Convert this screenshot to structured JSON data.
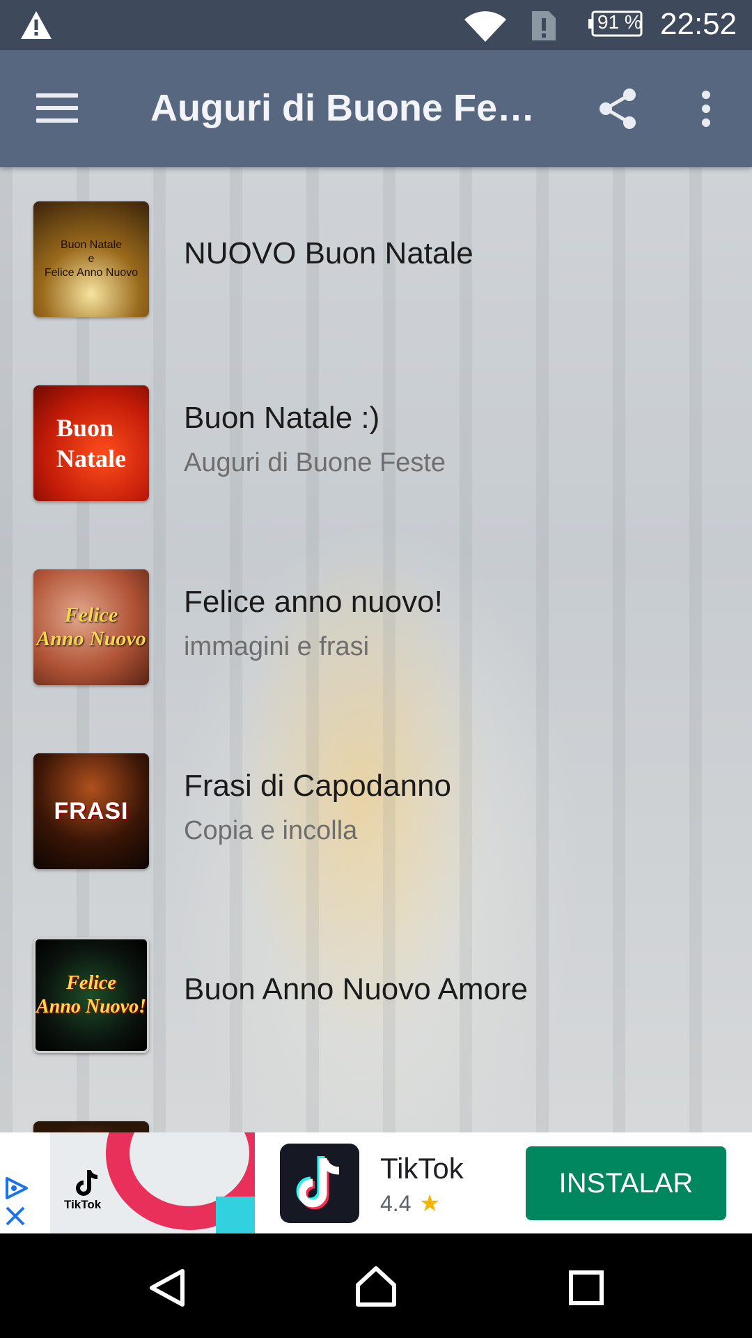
{
  "status_bar": {
    "battery": "91 %",
    "time": "22:52",
    "icons": [
      "warning-icon",
      "wifi-icon",
      "sim-alert-icon",
      "battery-icon"
    ]
  },
  "toolbar": {
    "title": "Auguri di Buone Fe…",
    "icons": [
      "menu-icon",
      "share-icon",
      "more-vert-icon"
    ]
  },
  "list": {
    "items": [
      {
        "title": "NUOVO Buon Natale",
        "subtitle": "",
        "thumb_text": "Buon Natale\ne\nFelice Anno Nuovo"
      },
      {
        "title": "Buon Natale :)",
        "subtitle": "Auguri di Buone Feste",
        "thumb_text": "Buon\nNatale"
      },
      {
        "title": "Felice anno nuovo!",
        "subtitle": "immagini e frasi",
        "thumb_text": "Felice\nAnno Nuovo"
      },
      {
        "title": "Frasi di Capodanno",
        "subtitle": "Copia e incolla",
        "thumb_text": "FRASI"
      },
      {
        "title": "Buon Anno Nuovo Amore",
        "subtitle": "",
        "thumb_text": "Felice\nAnno Nuovo!"
      }
    ]
  },
  "ad": {
    "creative_brand": "TikTok",
    "app_name": "TikTok",
    "rating": "4.4",
    "install_label": "INSTALAR",
    "colors": {
      "install": "#01875f",
      "star": "#f4b400"
    }
  },
  "nav_bar": {
    "icons": [
      "back-icon",
      "home-icon",
      "recents-icon"
    ]
  }
}
